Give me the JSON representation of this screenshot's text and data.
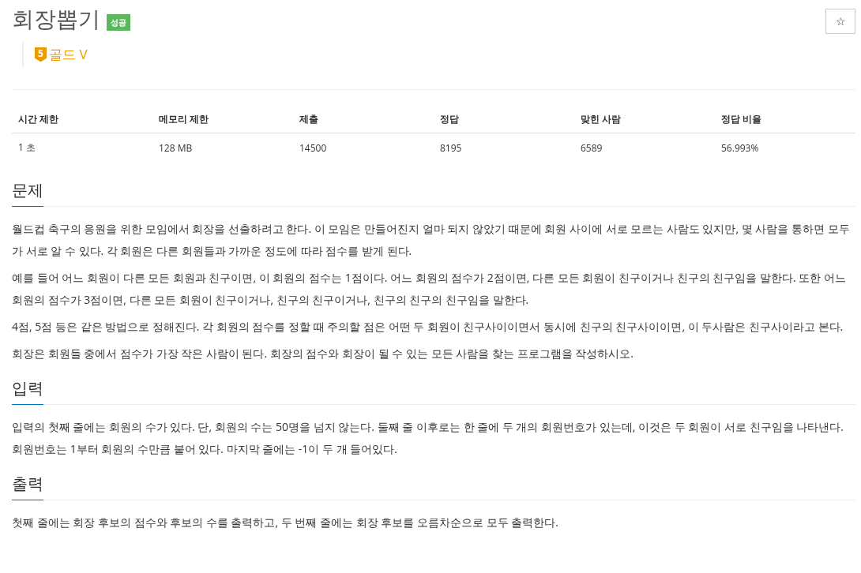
{
  "title": "회장뽑기",
  "result_badge": {
    "label": "성공",
    "kind": "success"
  },
  "star_button": {
    "label": "☆",
    "on": false
  },
  "tier": {
    "level": "5",
    "name": "골드 V",
    "kind": "gold"
  },
  "table": {
    "columns": [
      "시간 제한",
      "메모리 제한",
      "제출",
      "정답",
      "맞힌 사람",
      "정답 비율"
    ],
    "rows": [
      [
        "1 초",
        "128 MB",
        "14500",
        "8195",
        "6589",
        "56.993%"
      ]
    ]
  },
  "sections": [
    {
      "heading": "문제",
      "paragraphs": [
        "월드컵 축구의 응원을 위한 모임에서 회장을 선출하려고 한다. 이 모임은 만들어진지 얼마 되지 않았기 때문에 회원 사이에 서로 모르는 사람도 있지만, 몇 사람을 통하면 모두가 서로 알 수 있다. 각 회원은 다른 회원들과 가까운 정도에 따라 점수를 받게 된다.",
        "예를 들어 어느 회원이 다른 모든 회원과 친구이면, 이 회원의 점수는 1점이다. 어느 회원의 점수가 2점이면, 다른 모든 회원이 친구이거나 친구의 친구임을 말한다. 또한 어느 회원의 점수가 3점이면, 다른 모든 회원이 친구이거나, 친구의 친구이거나, 친구의 친구의 친구임을 말한다.",
        "4점, 5점 등은 같은 방법으로 정해진다. 각 회원의 점수를 정할 때 주의할 점은 어떤 두 회원이 친구사이이면서 동시에 친구의 친구사이이면, 이 두사람은 친구사이라고 본다.",
        "회장은 회원들 중에서 점수가 가장 작은 사람이 된다. 회장의 점수와 회장이 될 수 있는 모든 사람을 찾는 프로그램을 작성하시오."
      ]
    },
    {
      "heading": "입력",
      "paragraphs": [
        "입력의 첫째 줄에는 회원의 수가 있다. 단, 회원의 수는 50명을 넘지 않는다. 둘째 줄 이후로는 한 줄에 두 개의 회원번호가 있는데, 이것은 두 회원이 서로 친구임을 나타낸다. 회원번호는 1부터 회원의 수만큼 붙어 있다. 마지막 줄에는 -1이 두 개 들어있다."
      ]
    },
    {
      "heading": "출력",
      "paragraphs": [
        "첫째 줄에는 회장 후보의 점수와 후보의 수를 출력하고, 두 번째 줄에는 회장 후보를 오름차순으로 모두 출력한다."
      ]
    }
  ]
}
